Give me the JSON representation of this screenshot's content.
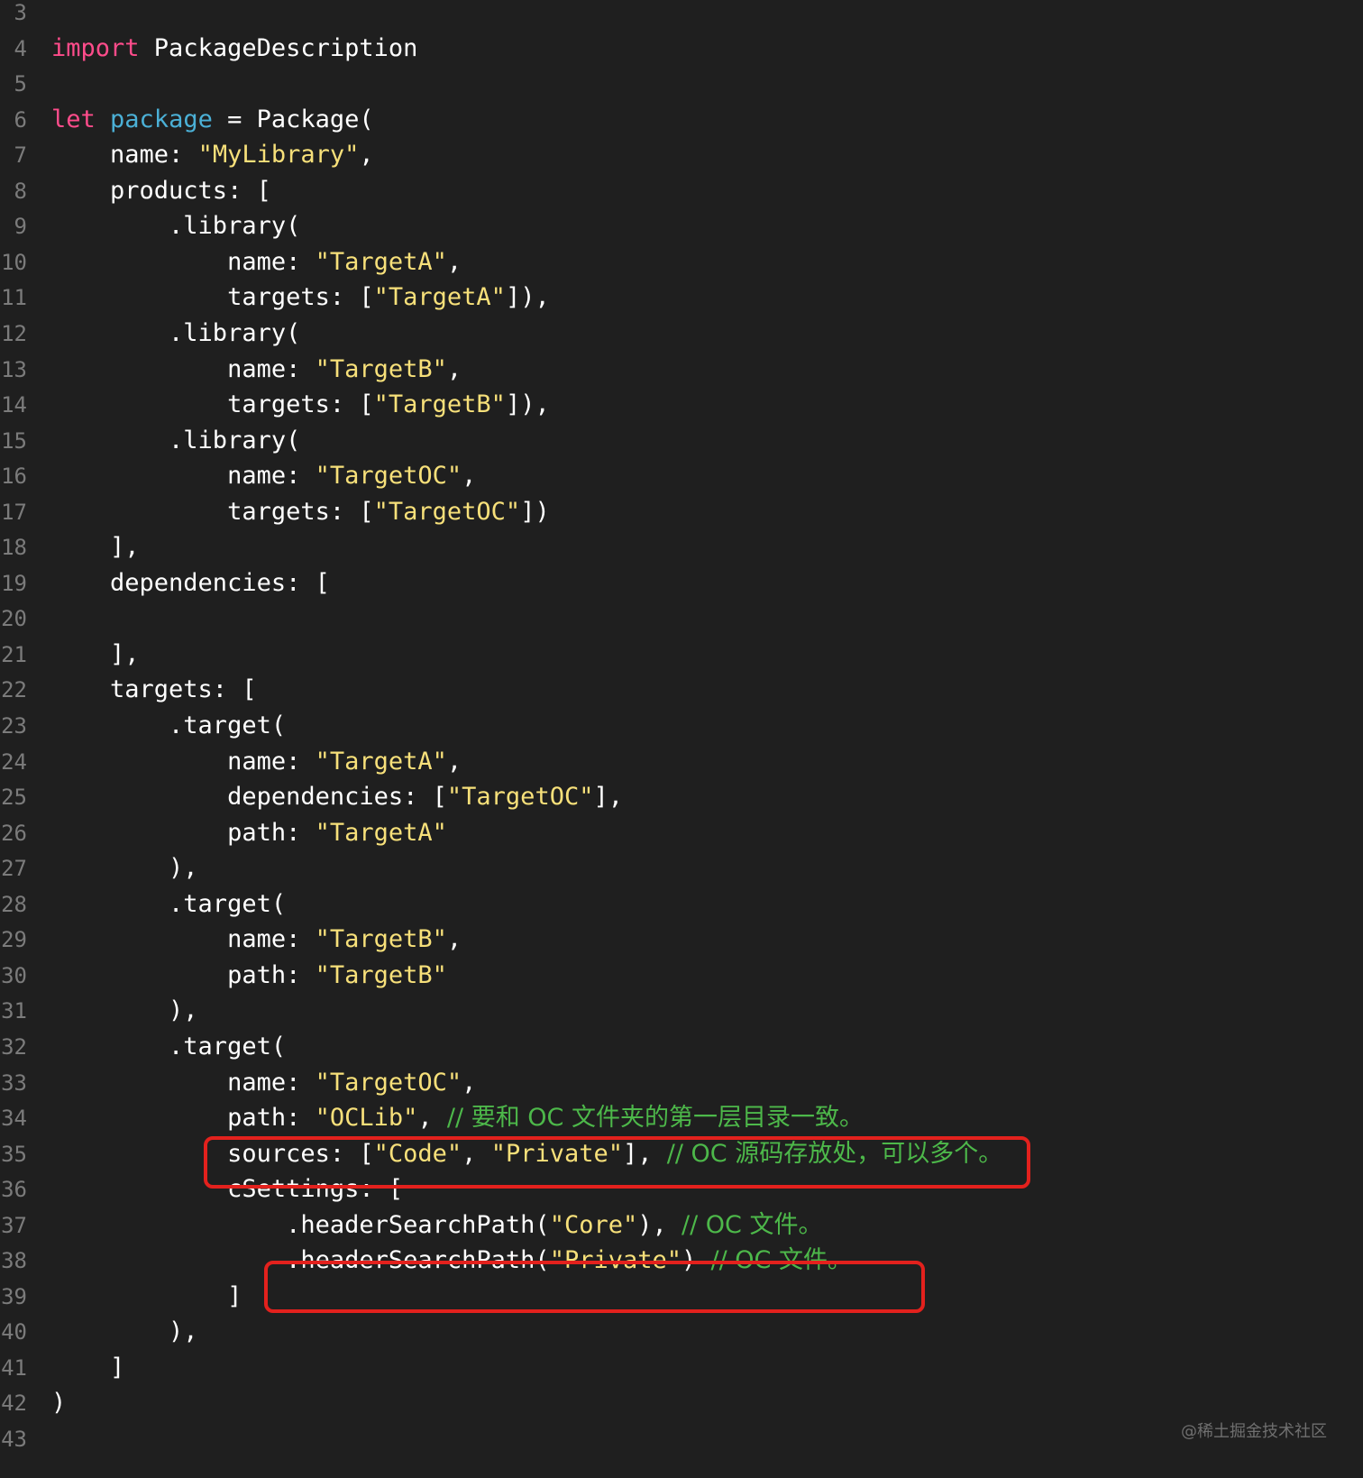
{
  "editor": {
    "lines": [
      {
        "num": "3",
        "tokens": []
      },
      {
        "num": "4",
        "tokens": [
          {
            "t": "kw",
            "v": "import"
          },
          {
            "t": "plain",
            "v": " PackageDescription"
          }
        ]
      },
      {
        "num": "5",
        "tokens": []
      },
      {
        "num": "6",
        "tokens": [
          {
            "t": "kw",
            "v": "let"
          },
          {
            "t": "plain",
            "v": " "
          },
          {
            "t": "decl",
            "v": "package"
          },
          {
            "t": "plain",
            "v": " = Package("
          }
        ]
      },
      {
        "num": "7",
        "tokens": [
          {
            "t": "plain",
            "v": "    name: "
          },
          {
            "t": "str",
            "v": "\"MyLibrary\""
          },
          {
            "t": "plain",
            "v": ","
          }
        ]
      },
      {
        "num": "8",
        "tokens": [
          {
            "t": "plain",
            "v": "    products: ["
          }
        ]
      },
      {
        "num": "9",
        "tokens": [
          {
            "t": "plain",
            "v": "        .library("
          }
        ]
      },
      {
        "num": "10",
        "tokens": [
          {
            "t": "plain",
            "v": "            name: "
          },
          {
            "t": "str",
            "v": "\"TargetA\""
          },
          {
            "t": "plain",
            "v": ","
          }
        ]
      },
      {
        "num": "11",
        "tokens": [
          {
            "t": "plain",
            "v": "            targets: ["
          },
          {
            "t": "str",
            "v": "\"TargetA\""
          },
          {
            "t": "plain",
            "v": "]),"
          }
        ]
      },
      {
        "num": "12",
        "tokens": [
          {
            "t": "plain",
            "v": "        .library("
          }
        ]
      },
      {
        "num": "13",
        "tokens": [
          {
            "t": "plain",
            "v": "            name: "
          },
          {
            "t": "str",
            "v": "\"TargetB\""
          },
          {
            "t": "plain",
            "v": ","
          }
        ]
      },
      {
        "num": "14",
        "tokens": [
          {
            "t": "plain",
            "v": "            targets: ["
          },
          {
            "t": "str",
            "v": "\"TargetB\""
          },
          {
            "t": "plain",
            "v": "]),"
          }
        ]
      },
      {
        "num": "15",
        "tokens": [
          {
            "t": "plain",
            "v": "        .library("
          }
        ]
      },
      {
        "num": "16",
        "tokens": [
          {
            "t": "plain",
            "v": "            name: "
          },
          {
            "t": "str",
            "v": "\"TargetOC\""
          },
          {
            "t": "plain",
            "v": ","
          }
        ]
      },
      {
        "num": "17",
        "tokens": [
          {
            "t": "plain",
            "v": "            targets: ["
          },
          {
            "t": "str",
            "v": "\"TargetOC\""
          },
          {
            "t": "plain",
            "v": "])"
          }
        ]
      },
      {
        "num": "18",
        "tokens": [
          {
            "t": "plain",
            "v": "    ],"
          }
        ]
      },
      {
        "num": "19",
        "tokens": [
          {
            "t": "plain",
            "v": "    dependencies: ["
          }
        ]
      },
      {
        "num": "20",
        "tokens": []
      },
      {
        "num": "21",
        "tokens": [
          {
            "t": "plain",
            "v": "    ],"
          }
        ]
      },
      {
        "num": "22",
        "tokens": [
          {
            "t": "plain",
            "v": "    targets: ["
          }
        ]
      },
      {
        "num": "23",
        "tokens": [
          {
            "t": "plain",
            "v": "        .target("
          }
        ]
      },
      {
        "num": "24",
        "tokens": [
          {
            "t": "plain",
            "v": "            name: "
          },
          {
            "t": "str",
            "v": "\"TargetA\""
          },
          {
            "t": "plain",
            "v": ","
          }
        ]
      },
      {
        "num": "25",
        "tokens": [
          {
            "t": "plain",
            "v": "            dependencies: ["
          },
          {
            "t": "str",
            "v": "\"TargetOC\""
          },
          {
            "t": "plain",
            "v": "],"
          }
        ]
      },
      {
        "num": "26",
        "tokens": [
          {
            "t": "plain",
            "v": "            path: "
          },
          {
            "t": "str",
            "v": "\"TargetA\""
          }
        ]
      },
      {
        "num": "27",
        "tokens": [
          {
            "t": "plain",
            "v": "        ),"
          }
        ]
      },
      {
        "num": "28",
        "tokens": [
          {
            "t": "plain",
            "v": "        .target("
          }
        ]
      },
      {
        "num": "29",
        "tokens": [
          {
            "t": "plain",
            "v": "            name: "
          },
          {
            "t": "str",
            "v": "\"TargetB\""
          },
          {
            "t": "plain",
            "v": ","
          }
        ]
      },
      {
        "num": "30",
        "tokens": [
          {
            "t": "plain",
            "v": "            path: "
          },
          {
            "t": "str",
            "v": "\"TargetB\""
          }
        ]
      },
      {
        "num": "31",
        "tokens": [
          {
            "t": "plain",
            "v": "        ),"
          }
        ]
      },
      {
        "num": "32",
        "tokens": [
          {
            "t": "plain",
            "v": "        .target("
          }
        ]
      },
      {
        "num": "33",
        "tokens": [
          {
            "t": "plain",
            "v": "            name: "
          },
          {
            "t": "str",
            "v": "\"TargetOC\""
          },
          {
            "t": "plain",
            "v": ","
          }
        ]
      },
      {
        "num": "34",
        "tokens": [
          {
            "t": "plain",
            "v": "            path: "
          },
          {
            "t": "str",
            "v": "\"OCLib\""
          },
          {
            "t": "plain",
            "v": ", "
          },
          {
            "t": "cmt",
            "v": "// 要和 OC 文件夹的第一层目录一致。"
          }
        ]
      },
      {
        "num": "35",
        "tokens": [
          {
            "t": "plain",
            "v": "            sources: ["
          },
          {
            "t": "str",
            "v": "\"Code\""
          },
          {
            "t": "plain",
            "v": ", "
          },
          {
            "t": "str",
            "v": "\"Private\""
          },
          {
            "t": "plain",
            "v": "], "
          },
          {
            "t": "cmt",
            "v": "// OC 源码存放处，可以多个。"
          }
        ]
      },
      {
        "num": "36",
        "tokens": [
          {
            "t": "plain",
            "v": "            cSettings: ["
          }
        ]
      },
      {
        "num": "37",
        "tokens": [
          {
            "t": "plain",
            "v": "                .headerSearchPath("
          },
          {
            "t": "str",
            "v": "\"Core\""
          },
          {
            "t": "plain",
            "v": "), "
          },
          {
            "t": "cmt",
            "v": "// OC 文件。"
          }
        ]
      },
      {
        "num": "38",
        "tokens": [
          {
            "t": "plain",
            "v": "                .headerSearchPath("
          },
          {
            "t": "str",
            "v": "\"Private\""
          },
          {
            "t": "plain",
            "v": ") "
          },
          {
            "t": "cmt",
            "v": "// OC 文件。"
          }
        ]
      },
      {
        "num": "39",
        "tokens": [
          {
            "t": "plain",
            "v": "            ]"
          }
        ]
      },
      {
        "num": "40",
        "tokens": [
          {
            "t": "plain",
            "v": "        ),"
          }
        ]
      },
      {
        "num": "41",
        "tokens": [
          {
            "t": "plain",
            "v": "    ]"
          }
        ]
      },
      {
        "num": "42",
        "tokens": [
          {
            "t": "plain",
            "v": ")"
          }
        ]
      },
      {
        "num": "43",
        "tokens": []
      }
    ],
    "highlighted_lines": [
      "35",
      "38"
    ]
  },
  "watermark": "@稀土掘金技术社区",
  "colors": {
    "background": "#1f1f1f",
    "keyword": "#ff4c8b",
    "declaration": "#4bb0d6",
    "string": "#f7e07a",
    "comment": "#4db84a",
    "line_number": "#7b7b7b",
    "highlight_box": "#e3211d"
  }
}
